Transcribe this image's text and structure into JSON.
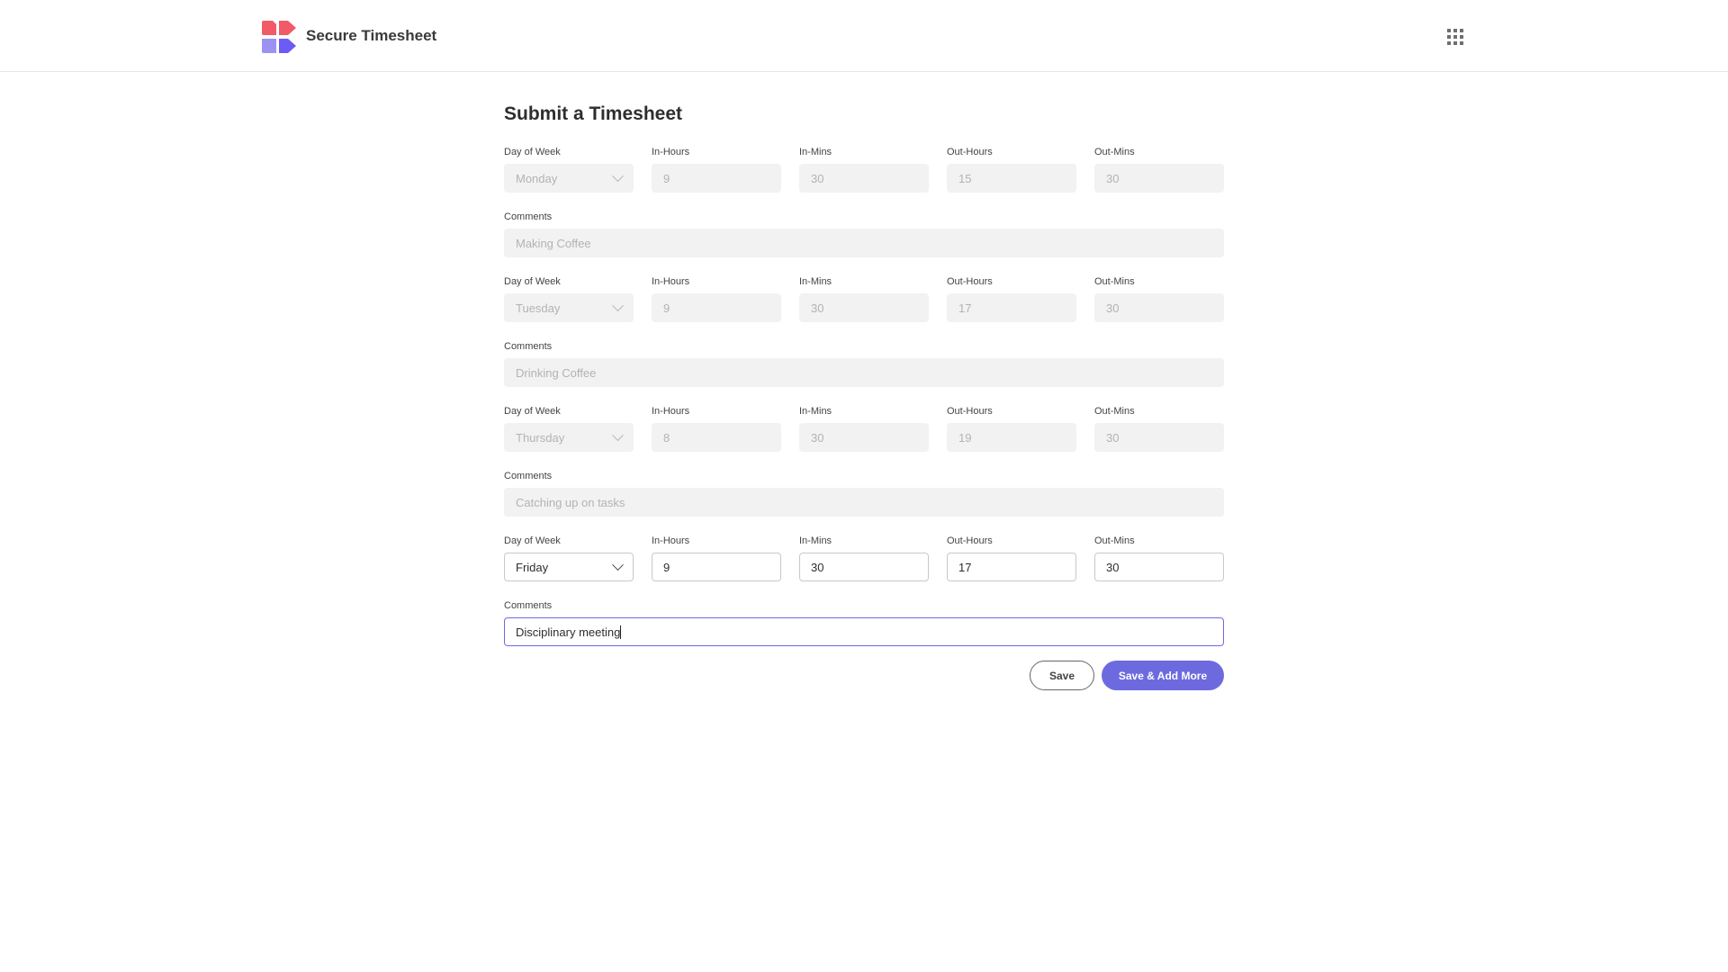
{
  "header": {
    "app_title": "Secure Timesheet",
    "logo_icon": "brand-logo-icon",
    "apps_icon": "apps-grid-icon",
    "colors": {
      "logo_top": "#f25a68",
      "logo_bottom": "#6b5cf5"
    }
  },
  "form": {
    "title": "Submit a Timesheet",
    "labels": {
      "day": "Day of Week",
      "in_hours": "In-Hours",
      "in_mins": "In-Mins",
      "out_hours": "Out-Hours",
      "out_mins": "Out-Mins",
      "comments": "Comments"
    },
    "entries": [
      {
        "day": "Monday",
        "in_hours": "9",
        "in_mins": "30",
        "out_hours": "15",
        "out_mins": "30",
        "comments": "Making Coffee",
        "disabled": true
      },
      {
        "day": "Tuesday",
        "in_hours": "9",
        "in_mins": "30",
        "out_hours": "17",
        "out_mins": "30",
        "comments": "Drinking Coffee",
        "disabled": true
      },
      {
        "day": "Thursday",
        "in_hours": "8",
        "in_mins": "30",
        "out_hours": "19",
        "out_mins": "30",
        "comments": "Catching up on tasks",
        "disabled": true
      },
      {
        "day": "Friday",
        "in_hours": "9",
        "in_mins": "30",
        "out_hours": "17",
        "out_mins": "30",
        "comments": "Disciplinary meeting",
        "disabled": false
      }
    ],
    "buttons": {
      "save": "Save",
      "save_add_more": "Save & Add More"
    },
    "accent_color": "#6d6ae0"
  }
}
